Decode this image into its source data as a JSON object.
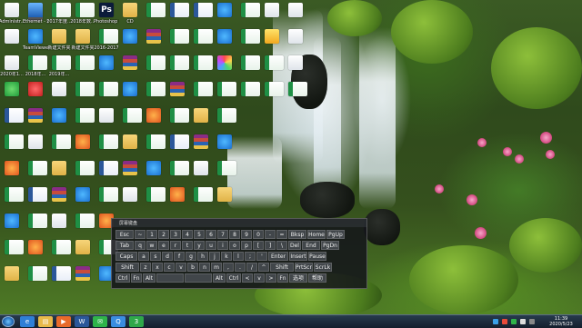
{
  "desktop_icons": [
    {
      "label": "Administr...",
      "type": "t-doc"
    },
    {
      "label": "Ethernet - 快捷方式",
      "type": "t-monitor"
    },
    {
      "label": "2017年度...",
      "type": "t-excel"
    },
    {
      "label": "2018年数...",
      "type": "t-excel"
    },
    {
      "label": "Photoshop CS6",
      "type": "t-ps",
      "glyph": "Ps"
    },
    {
      "label": "CD",
      "type": "t-folder"
    },
    {
      "label": "",
      "type": "t-excel"
    },
    {
      "label": "",
      "type": "t-word"
    },
    {
      "label": "",
      "type": "t-word"
    },
    {
      "label": "",
      "type": "t-app-blue"
    },
    {
      "label": "",
      "type": "t-excel"
    },
    {
      "label": "",
      "type": "t-doc"
    },
    {
      "label": "",
      "type": "t-doc"
    },
    {
      "label": "",
      "type": "t-doc"
    },
    {
      "label": "TeamViewer",
      "type": "t-app-blue"
    },
    {
      "label": "新建文件夹",
      "type": "t-folder"
    },
    {
      "label": "新建文件夹",
      "type": "t-folder"
    },
    {
      "label": "2016-2017",
      "type": "t-excel"
    },
    {
      "label": "",
      "type": "t-app-blue"
    },
    {
      "label": "",
      "type": "t-rar"
    },
    {
      "label": "",
      "type": "t-excel"
    },
    {
      "label": "",
      "type": "t-excel"
    },
    {
      "label": "",
      "type": "t-app-blue"
    },
    {
      "label": "",
      "type": "t-excel"
    },
    {
      "label": "",
      "type": "t-yellow"
    },
    {
      "label": "",
      "type": "t-doc"
    },
    {
      "label": "2020年1...",
      "type": "t-doc"
    },
    {
      "label": "2018年...",
      "type": "t-excel"
    },
    {
      "label": "2019年...",
      "type": "t-excel"
    },
    {
      "label": "",
      "type": "t-excel"
    },
    {
      "label": "",
      "type": "t-app-blue"
    },
    {
      "label": "",
      "type": "t-rar"
    },
    {
      "label": "",
      "type": "t-excel"
    },
    {
      "label": "",
      "type": "t-excel"
    },
    {
      "label": "",
      "type": "t-excel"
    },
    {
      "label": "",
      "type": "t-colorful"
    },
    {
      "label": "",
      "type": "t-excel"
    },
    {
      "label": "",
      "type": "t-excel"
    },
    {
      "label": "",
      "type": "t-doc"
    },
    {
      "label": "",
      "type": "t-app-green"
    },
    {
      "label": "",
      "type": "t-app-red"
    },
    {
      "label": "",
      "type": "t-doc"
    },
    {
      "label": "",
      "type": "t-excel"
    },
    {
      "label": "",
      "type": "t-excel"
    },
    {
      "label": "",
      "type": "t-app-blue"
    },
    {
      "label": "",
      "type": "t-excel"
    },
    {
      "label": "",
      "type": "t-rar"
    },
    {
      "label": "",
      "type": "t-excel"
    },
    {
      "label": "",
      "type": "t-excel"
    },
    {
      "label": "",
      "type": "t-excel"
    },
    {
      "label": "",
      "type": "t-excel"
    },
    {
      "label": "",
      "type": "t-excel"
    }
  ],
  "keyboard": {
    "title": "屏幕键盘",
    "rows": [
      [
        "Esc",
        "~",
        "1",
        "2",
        "3",
        "4",
        "5",
        "6",
        "7",
        "8",
        "9",
        "0",
        "-",
        "=",
        "Bksp",
        "Home",
        "PgUp"
      ],
      [
        "Tab",
        "q",
        "w",
        "e",
        "r",
        "t",
        "y",
        "u",
        "i",
        "o",
        "p",
        "[",
        "]",
        "\\",
        "Del",
        "End",
        "PgDn"
      ],
      [
        "Caps",
        "a",
        "s",
        "d",
        "f",
        "g",
        "h",
        "j",
        "k",
        "l",
        ";",
        "'",
        "Enter",
        "Insert",
        "Pause"
      ],
      [
        "Shift",
        "z",
        "x",
        "c",
        "v",
        "b",
        "n",
        "m",
        ",",
        ".",
        "/",
        "^",
        "Shift",
        "PrtScn",
        "ScrLk"
      ],
      [
        "Ctrl",
        "Fn",
        "Alt",
        "",
        "",
        "Alt",
        "Ctrl",
        "<",
        "v",
        ">",
        "Fn",
        "选项",
        "帮助"
      ]
    ]
  },
  "taskbar": {
    "start_label": "",
    "pinned": [
      {
        "name": "ie",
        "color": "#2f7fd6",
        "glyph": "e"
      },
      {
        "name": "explorer",
        "color": "#e8b94a",
        "glyph": "▤"
      },
      {
        "name": "media",
        "color": "#e86a2a",
        "glyph": "▶"
      },
      {
        "name": "word",
        "color": "#2b579a",
        "glyph": "W"
      },
      {
        "name": "wechat",
        "color": "#2fb34a",
        "glyph": "✉"
      },
      {
        "name": "qq",
        "color": "#3a8de0",
        "glyph": "Q"
      },
      {
        "name": "360",
        "color": "#2fa84a",
        "glyph": "3"
      }
    ],
    "clock_time": "11:39",
    "clock_date": "2020/5/23"
  }
}
